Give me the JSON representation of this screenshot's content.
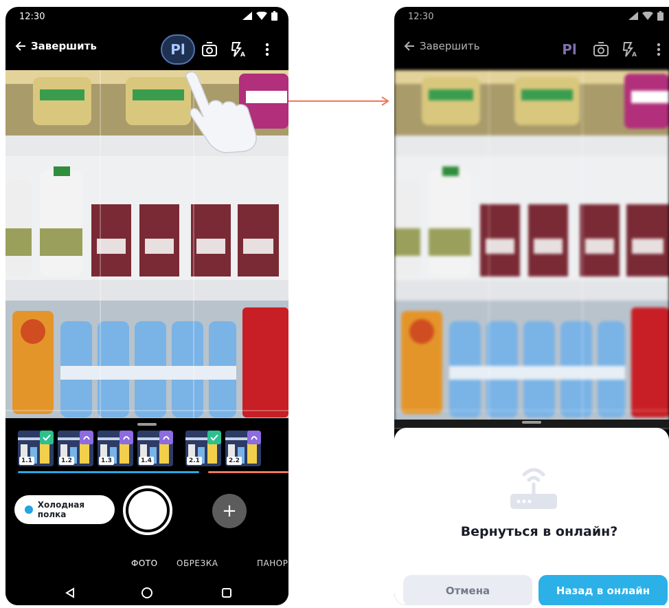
{
  "left_screen": {
    "status": {
      "time": "12:30"
    },
    "topbar": {
      "back_label": "Завершить",
      "pl_label": "Pl"
    },
    "thumbnails": [
      {
        "label": "1.1",
        "status": "check"
      },
      {
        "label": "1.2",
        "status": "pending"
      },
      {
        "label": "1.3",
        "status": "pending"
      },
      {
        "label": "1.4",
        "status": "pending"
      },
      {
        "label": "2.1",
        "status": "check"
      },
      {
        "label": "2.2",
        "status": "pending"
      }
    ],
    "category_chip": "Холодная полка",
    "modes": {
      "photo": "ФОТО",
      "crop": "ОБРЕЗКА",
      "pano": "ПАНОР"
    },
    "plus_label": "+"
  },
  "right_screen": {
    "status": {
      "time": "12:30"
    },
    "topbar": {
      "back_label": "Завершить",
      "pl_label": "Pl"
    },
    "dialog": {
      "icon": "router-wifi-icon",
      "title": "Вернуться в онлайн?",
      "cancel": "Отмена",
      "confirm": "Назад в онлайн"
    }
  },
  "colors": {
    "accent_blue": "#2cb0e8",
    "check_green": "#2fbf8f",
    "pending_purple": "#8c6ce0",
    "group1_line": "#29a8e6",
    "group2_line": "#f0775a",
    "arrow": "#f0775a"
  }
}
